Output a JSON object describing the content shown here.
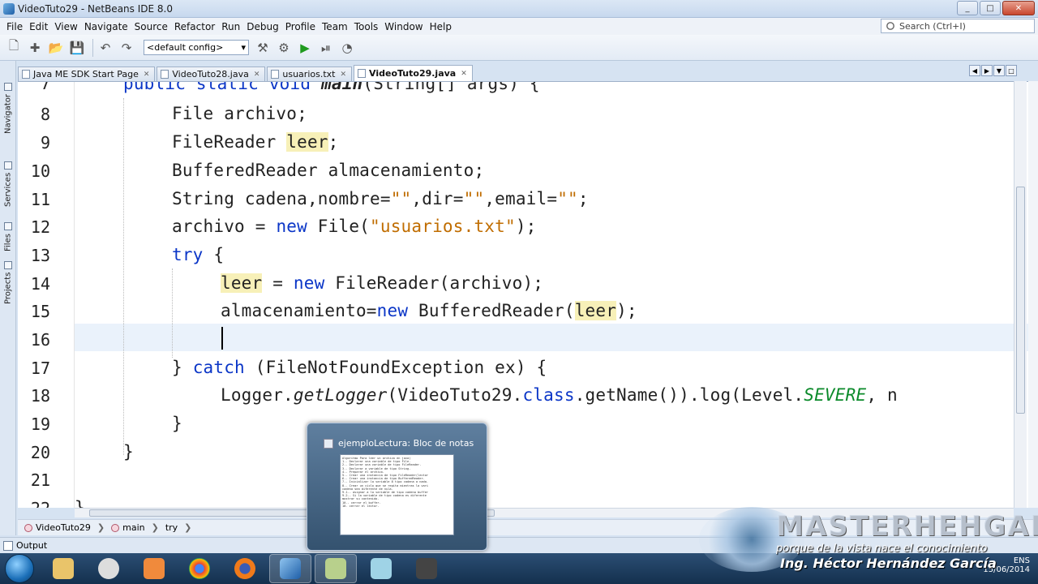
{
  "window": {
    "title": "VideoTuto29 - NetBeans IDE 8.0",
    "controls": [
      "_",
      "□",
      "✕"
    ]
  },
  "menu": [
    "File",
    "Edit",
    "View",
    "Navigate",
    "Source",
    "Refactor",
    "Run",
    "Debug",
    "Profile",
    "Team",
    "Tools",
    "Window",
    "Help"
  ],
  "search": {
    "placeholder": "Search (Ctrl+I)"
  },
  "toolbar": {
    "config": "<default config>"
  },
  "left_tabs": [
    "Navigator",
    "Services",
    "Files",
    "Projects"
  ],
  "editor_tabs": [
    {
      "label": "Java ME SDK Start Page",
      "active": false
    },
    {
      "label": "VideoTuto28.java",
      "active": false
    },
    {
      "label": "usuarios.txt",
      "active": false
    },
    {
      "label": "VideoTuto29.java",
      "active": true
    }
  ],
  "code": {
    "line_numbers": [
      "7",
      "8",
      "9",
      "10",
      "11",
      "12",
      "13",
      "14",
      "15",
      "16",
      "17",
      "18",
      "19",
      "20",
      "21",
      "22"
    ],
    "l7": {
      "kw1": "public",
      "kw2": "static",
      "kw3": "void",
      "name": "main",
      "rest": "(String[] args) {"
    },
    "l8": "File archivo;",
    "l9": {
      "a": "FileReader ",
      "b": "leer",
      "c": ";"
    },
    "l10": "BufferedReader almacenamiento;",
    "l11": {
      "a": "String cadena,nombre=",
      "s1": "\"\"",
      "b": ",dir=",
      "s2": "\"\"",
      "c": ",email=",
      "s3": "\"\"",
      "d": ";"
    },
    "l12": {
      "a": "archivo = ",
      "kw": "new",
      "b": " File(",
      "s": "\"usuarios.txt\"",
      "c": ");"
    },
    "l13": {
      "kw": "try",
      "b": " {"
    },
    "l14": {
      "hl": "leer",
      "a": " = ",
      "kw": "new",
      "b": " FileReader(archivo);"
    },
    "l15": {
      "a": "almacenamiento=",
      "kw": "new",
      "b": " BufferedReader(",
      "hl": "leer",
      "c": ");"
    },
    "l17": {
      "a": "} ",
      "kw": "catch",
      "b": " (FileNotFoundException ex) {"
    },
    "l18": {
      "a": "Logger.",
      "it": "getLogger",
      "b": "(VideoTuto29.",
      "kw": "class",
      "c": ".getName()).log(Level.",
      "sev": "SEVERE",
      "d": ", n"
    },
    "l19": "}",
    "l20": "}",
    "l22": "}"
  },
  "breadcrumb": [
    "VideoTuto29",
    "main",
    "try"
  ],
  "output": {
    "label": "Output"
  },
  "popup": {
    "title": "ejemploLectura: Bloc de notas",
    "preview_text": "Algoritmo Para leer un archivo en java)\n1.- Declarar una variable de tipo File.\n2.- Declarar una variable de tipo FileReader.\n3.- Declarar a variable de tipo String.\n4.- Preparar el archivo.\n5.- Crear una instancia de tipo FileReader(lector\n6.- Crear una instancia de tipo BufferedReader.\n7.- Inicializar la variable 8 tipo cadena a nada.\n8.- Crear un ciclo que se repita mientras la vari\ncadena sea diferente de nula.\n9.1.- asignar a la variable de tipo cadena buffer\n9.2.- Si la variable de tipo cadena es diferente\nmostrar su contenido.\n10.- cerrar el buffer.\n10. cerrar el lector."
  },
  "watermark": {
    "brand": "MASTERHEHGAR",
    "slogan": "porque de la vista nace el conocimiento",
    "author": "Ing. Héctor Hernández García"
  },
  "tray": {
    "lang": "ENS",
    "date": "15/06/2014"
  },
  "colors": {
    "keyword": "#0b36c7",
    "string": "#c06d00",
    "highlight": "#f7f0b8",
    "current_line": "#eaf2fb",
    "static_field": "#0b8a2a"
  }
}
